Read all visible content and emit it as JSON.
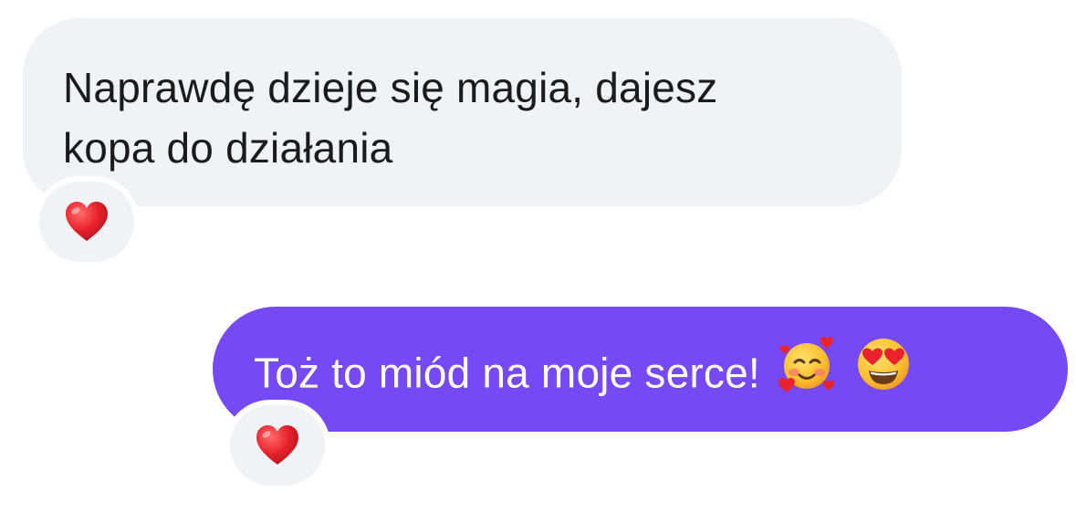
{
  "conversation": {
    "messages": [
      {
        "direction": "incoming",
        "lines": [
          "Naprawdę dzieje się magia, dajesz",
          "kopa do działania"
        ],
        "reaction": "heart-emoji"
      },
      {
        "direction": "outgoing",
        "text": "Toż to miód na moje serce!",
        "emojis": [
          "smiling-face-with-hearts-emoji",
          "heart-eyes-emoji"
        ],
        "reaction": "heart-emoji"
      }
    ]
  },
  "colors": {
    "incoming_bubble": "#f1f2f6",
    "outgoing_bubble": "#7549f4",
    "incoming_text": "#1b1b1d",
    "outgoing_text": "#ffffff",
    "heart": "#e8232e"
  }
}
